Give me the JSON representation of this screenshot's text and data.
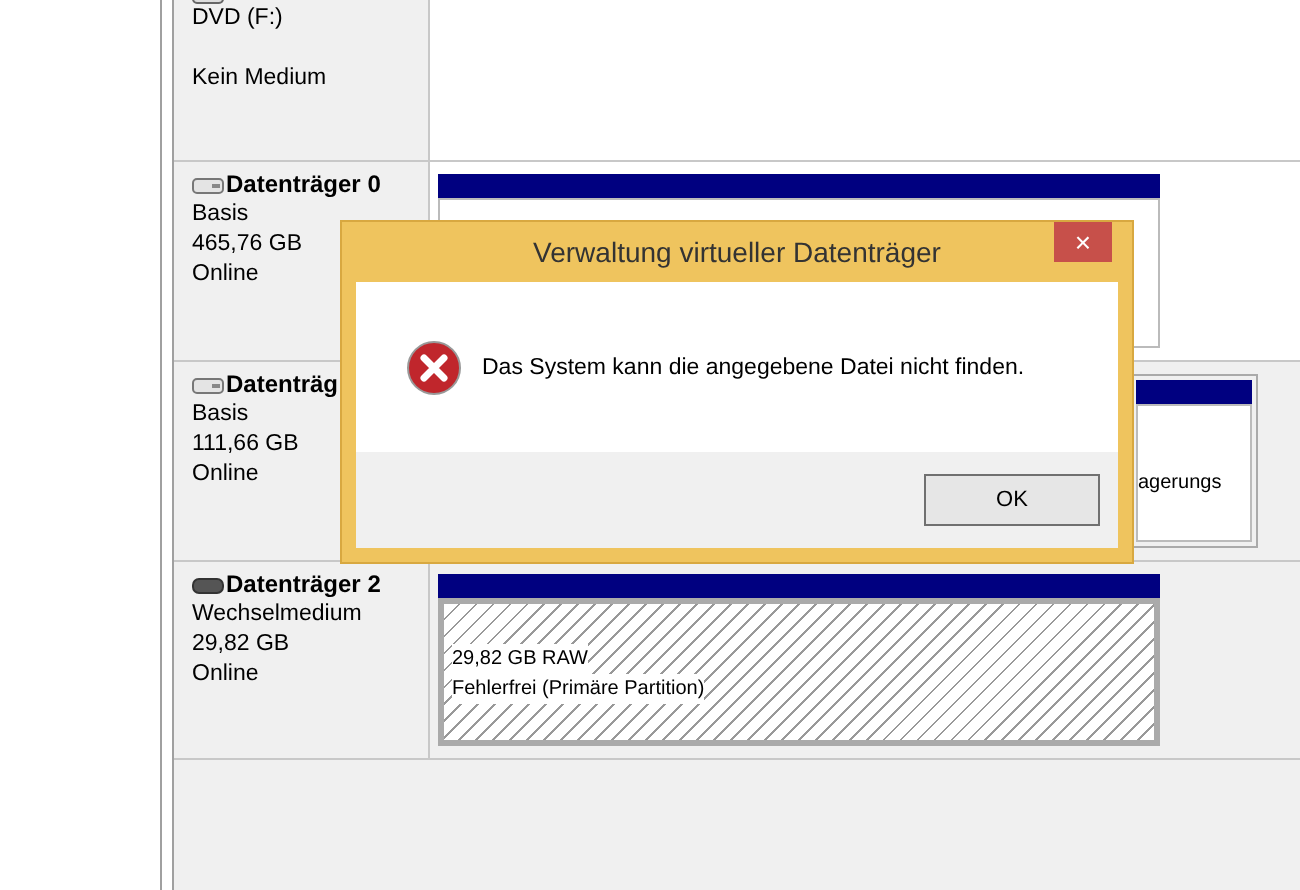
{
  "disks": [
    {
      "kind": "optical",
      "lines": [
        "DVD (F:)",
        "Kein Medium"
      ]
    },
    {
      "kind": "disk",
      "name": "Datenträger 0",
      "lines": [
        "Basis",
        "465,76 GB",
        "Online"
      ],
      "partitions": [
        {
          "kind": "primary"
        }
      ]
    },
    {
      "kind": "disk",
      "name": "Datenträg",
      "lines": [
        "Basis",
        "111,66 GB",
        "Online"
      ],
      "partitions": [
        {
          "kind": "primary",
          "lines": [
            "agerungs"
          ]
        }
      ]
    },
    {
      "kind": "removable",
      "name": "Datenträger 2",
      "lines": [
        "Wechselmedium",
        "29,82 GB",
        "Online"
      ],
      "partitions": [
        {
          "kind": "raw",
          "lines": [
            "29,82 GB RAW",
            "Fehlerfrei (Primäre Partition)"
          ]
        }
      ]
    }
  ],
  "dialog": {
    "title": "Verwaltung virtueller Datenträger",
    "close": "×",
    "message": "Das System kann die angegebene Datei nicht finden.",
    "buttons": [
      "OK"
    ]
  }
}
